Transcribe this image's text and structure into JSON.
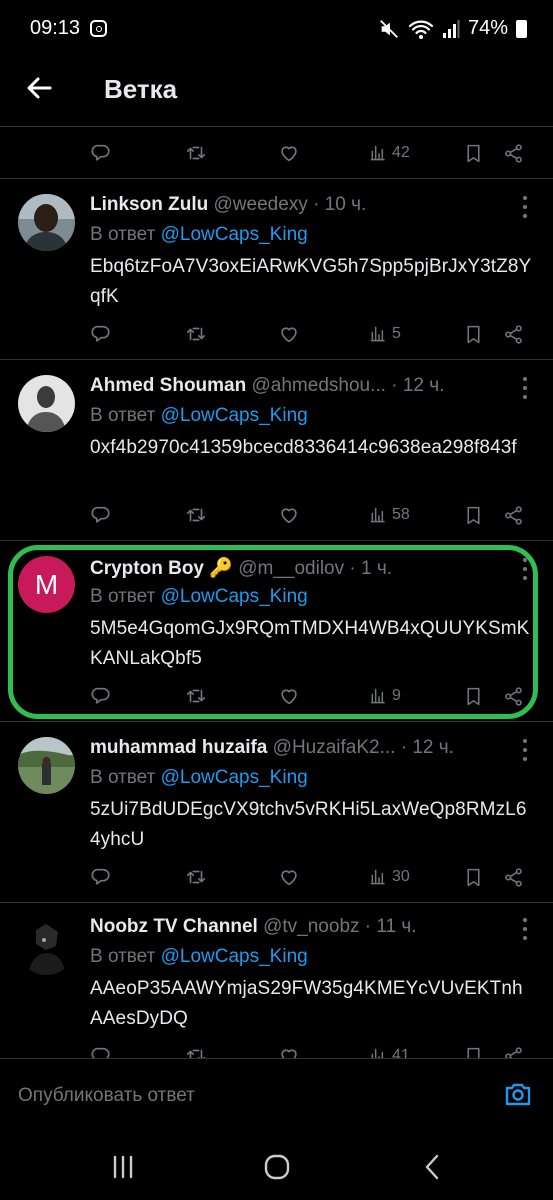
{
  "status_bar": {
    "time": "09:13",
    "battery": "74%"
  },
  "header": {
    "title": "Ветка"
  },
  "top_actions": {
    "views": "42"
  },
  "tweets": [
    {
      "name": "Linkson Zulu",
      "handle": "@weedexy",
      "time": "· 10 ч.",
      "reply_prefix": "В ответ",
      "reply_to": "@LowCaps_King",
      "body": "Ebq6tzFoA7V3oxEiARwKVG5h7Spp5pjBrJxY3tZ8YqfK",
      "views": "5"
    },
    {
      "name": "Ahmed Shouman",
      "handle": "@ahmedshou...",
      "time": "· 12 ч.",
      "reply_prefix": "В ответ",
      "reply_to": "@LowCaps_King",
      "body": "0xf4b2970c41359bcecd8336414c9638ea298f843f",
      "views": "58"
    },
    {
      "name": "Crypton Boy 🔑",
      "handle": "@m__odilov",
      "time": "· 1 ч.",
      "avatar_letter": "M",
      "reply_prefix": "В ответ",
      "reply_to": "@LowCaps_King",
      "body": "5M5e4GqomGJx9RQmTMDXH4WB4xQUUYKSmKKANLakQbf5",
      "views": "9"
    },
    {
      "name": "muhammad huzaifa",
      "handle": "@HuzaifaK2...",
      "time": "· 12 ч.",
      "reply_prefix": "В ответ",
      "reply_to": "@LowCaps_King",
      "body": "5zUi7BdUDEgcVX9tchv5vRKHi5LaxWeQp8RMzL64yhcU",
      "views": "30"
    },
    {
      "name": "Noobz TV Channel",
      "handle": "@tv_noobz",
      "time": "· 11 ч.",
      "reply_prefix": "В ответ",
      "reply_to": "@LowCaps_King",
      "body": "AAeoP35AAWYmjaS29FW35g4KMEYcVUvEKTnhAAesDyDQ",
      "views": "41"
    }
  ],
  "compose": {
    "placeholder": "Опубликовать ответ"
  },
  "colors": {
    "accent": "#1d9bf0",
    "highlight": "#2fbf50",
    "muted": "#71767b",
    "avatar_m": "#c8195a"
  },
  "icons": [
    "back-arrow-icon",
    "reply-icon",
    "retweet-icon",
    "like-icon",
    "views-icon",
    "bookmark-icon",
    "share-icon",
    "more-icon",
    "camera-icon",
    "recents-icon",
    "home-icon",
    "nav-back-icon"
  ]
}
